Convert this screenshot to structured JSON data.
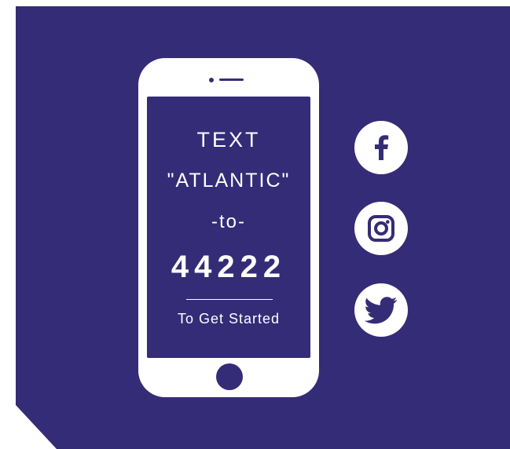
{
  "colors": {
    "background_panel": "#352c77",
    "foreground": "#ffffff"
  },
  "phone": {
    "line1": "TEXT",
    "line2": "\"ATLANTIC\"",
    "line3": "-to-",
    "number": "44222",
    "tagline": "To Get Started"
  },
  "social": {
    "icons": [
      "facebook-icon",
      "instagram-icon",
      "twitter-icon"
    ]
  }
}
